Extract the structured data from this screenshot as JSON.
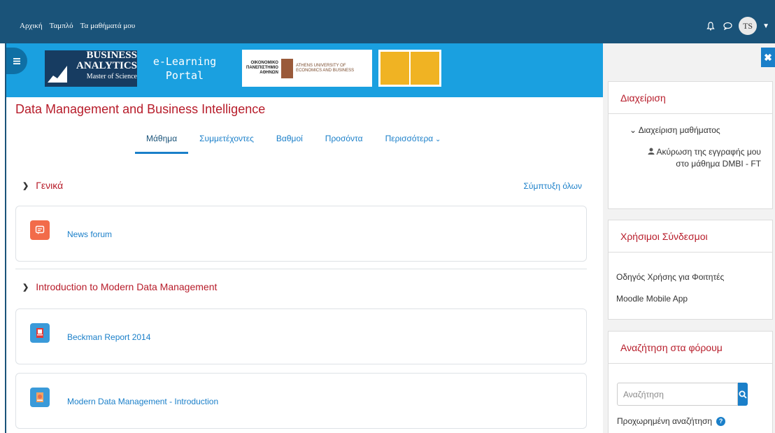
{
  "topbar": {
    "nav": [
      "Αρχική",
      "Ταμπλό",
      "Τα μαθήματά μου"
    ],
    "user_initials": "TS",
    "icons": [
      "bell-icon",
      "chat-icon"
    ]
  },
  "banner": {
    "logo_line1": "BUSINESS",
    "logo_line2": "ANALYTICS",
    "logo_line3": "Master of Science",
    "portal_line1": "e-Learning",
    "portal_line2": "Portal",
    "partner_gr": "ΟΙΚΟΝΟΜΙΚΟ ΠΑΝΕΠΙΣΤΗΜΙΟ ΑΘΗΝΩΝ",
    "partner_en": "ATHENS UNIVERSITY OF ECONOMICS AND BUSINESS"
  },
  "course": {
    "title": "Data Management and Business Intelligence",
    "tabs": [
      "Μάθημα",
      "Συμμετέχοντες",
      "Βαθμοί",
      "Προσόντα",
      "Περισσότερα"
    ],
    "collapse_all": "Σύμπτυξη όλων"
  },
  "sections": [
    {
      "title": "Γενικά",
      "activities": [
        {
          "label": "News forum",
          "icon": "forum-icon"
        }
      ]
    },
    {
      "title": "Introduction to Modern Data Management",
      "activities": [
        {
          "label": "Beckman Report 2014",
          "icon": "pdf-icon"
        },
        {
          "label": "Modern Data Management - Introduction",
          "icon": "presentation-icon"
        }
      ]
    }
  ],
  "sidebar": {
    "admin": {
      "title": "Διαχείριση",
      "item": "Διαχείριση μαθήματος",
      "unenrol": "Ακύρωση της εγγραφής μου στο μάθημα DMBI - FT"
    },
    "links": {
      "title": "Χρήσιμοι Σύνδεσμοι",
      "items": [
        "Οδηγός Χρήσης για Φοιτητές",
        "Moodle Mobile App"
      ]
    },
    "forum_search": {
      "title": "Αναζήτηση στα φόρουμ",
      "placeholder": "Αναζήτηση",
      "advanced": "Προχωρημένη αναζήτηση"
    }
  },
  "colors": {
    "navbar": "#1a5379",
    "banner": "#1aa0e0",
    "accent": "#1a7fc9",
    "heading_red": "#b71c2a"
  }
}
